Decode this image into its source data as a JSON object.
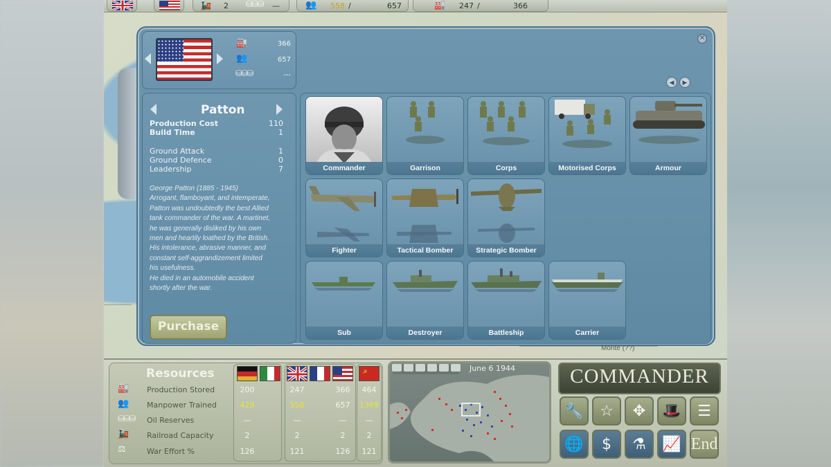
{
  "top_bar": {
    "rail_count": "2",
    "oil": "—",
    "manpower_used": "558",
    "manpower_separator": "/",
    "manpower_total": "657",
    "production_used": "247",
    "production_separator": "/",
    "production_total": "366"
  },
  "map_label": "Monte (??)",
  "country_panel": {
    "stats": [
      {
        "icon": "factory-icon",
        "value": "366"
      },
      {
        "icon": "manpower-icon",
        "value": "657"
      },
      {
        "icon": "oil-barrels-icon",
        "value": "---"
      }
    ]
  },
  "unit_info": {
    "name": "Patton",
    "production_cost_label": "Production Cost",
    "production_cost": "110",
    "build_time_label": "Build Time",
    "build_time": "1",
    "ground_attack_label": "Ground Attack",
    "ground_attack": "1",
    "ground_defence_label": "Ground Defence",
    "ground_defence": "0",
    "leadership_label": "Leadership",
    "leadership": "7",
    "bio": [
      "George Patton (1885 - 1945)",
      "Arrogant, flamboyant, and intemperate,",
      "Patton was undoubtedly the best Allied",
      "tank commander of the war. A martinet,",
      "he was generally disliked by his own",
      "men and heartily loathed by the British.",
      "His intolerance, abrasive manner, and",
      "constant self-aggrandizement limited",
      "his usefulness.",
      "He died in an automobile accident",
      "shortly after the war."
    ],
    "purchase_label": "Purchase"
  },
  "units": [
    {
      "label": "Commander"
    },
    {
      "label": "Garrison"
    },
    {
      "label": "Corps"
    },
    {
      "label": "Motorised Corps"
    },
    {
      "label": "Armour"
    },
    {
      "label": "Fighter"
    },
    {
      "label": "Tactical Bomber"
    },
    {
      "label": "Strategic Bomber"
    },
    {
      "label": "Sub"
    },
    {
      "label": "Destroyer"
    },
    {
      "label": "Battleship"
    },
    {
      "label": "Carrier"
    }
  ],
  "resources": {
    "title": "Resources",
    "rows": [
      {
        "label": "Production Stored",
        "axis": "200",
        "allies": [
          "247",
          "366"
        ],
        "ussr": "464"
      },
      {
        "label": "Manpower Trained",
        "axis": "429",
        "allies": [
          "558",
          "657"
        ],
        "ussr": "1369"
      },
      {
        "label": "Oil Reserves",
        "axis": "—",
        "allies": [
          "—",
          "—"
        ],
        "ussr": "—"
      },
      {
        "label": "Railroad Capacity",
        "axis": "2",
        "allies": [
          "2",
          "2"
        ],
        "ussr": "2"
      },
      {
        "label": "War Effort %",
        "axis": "126",
        "allies": [
          "121",
          "126"
        ],
        "ussr": "121"
      }
    ]
  },
  "minimap": {
    "date": "June 6 1944"
  },
  "commander_title": "COMMANDER",
  "end_label": "End",
  "colors": {
    "dialog": "#5e8aa5",
    "purchase": "#9ea472",
    "yellow_value": "#e8e43a"
  }
}
